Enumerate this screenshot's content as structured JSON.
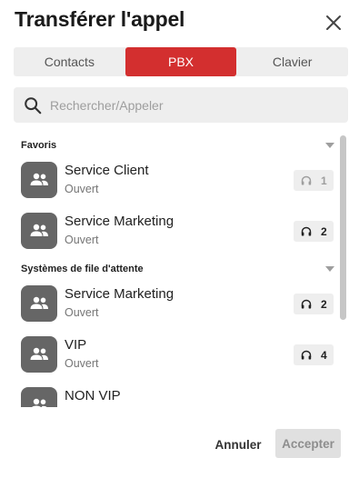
{
  "dialog": {
    "title": "Transférer l'appel",
    "close_icon": "close-icon"
  },
  "tabs": [
    {
      "label": "Contacts",
      "active": false
    },
    {
      "label": "PBX",
      "active": true
    },
    {
      "label": "Clavier",
      "active": false
    }
  ],
  "search": {
    "placeholder": "Rechercher/Appeler",
    "value": "",
    "icon": "search-icon"
  },
  "sections": [
    {
      "title": "Favoris",
      "items": [
        {
          "name": "Service Client",
          "status": "Ouvert",
          "agents": "1",
          "badge_state": "inactive"
        },
        {
          "name": "Service Marketing",
          "status": "Ouvert",
          "agents": "2",
          "badge_state": "active"
        }
      ]
    },
    {
      "title": "Systèmes de file d'attente",
      "items": [
        {
          "name": "Service Marketing",
          "status": "Ouvert",
          "agents": "2",
          "badge_state": "active"
        },
        {
          "name": "VIP",
          "status": "Ouvert",
          "agents": "4",
          "badge_state": "active"
        },
        {
          "name": "NON VIP",
          "status": "",
          "agents": "",
          "badge_state": "hidden"
        }
      ]
    }
  ],
  "footer": {
    "cancel_label": "Annuler",
    "accept_label": "Accepter"
  },
  "colors": {
    "accent": "#d32f2f",
    "avatar": "#666666",
    "tab_bg": "#eeeeee"
  }
}
